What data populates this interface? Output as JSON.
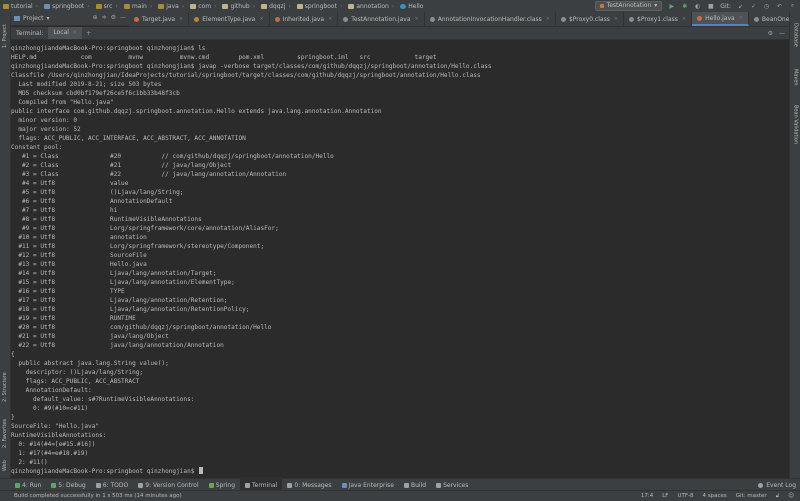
{
  "breadcrumbs": [
    {
      "label": "tutorial",
      "kind": "folder"
    },
    {
      "label": "springboot",
      "kind": "module"
    },
    {
      "label": "src",
      "kind": "folder"
    },
    {
      "label": "main",
      "kind": "folder"
    },
    {
      "label": "java",
      "kind": "folder"
    },
    {
      "label": "com",
      "kind": "package"
    },
    {
      "label": "github",
      "kind": "package"
    },
    {
      "label": "dqqzj",
      "kind": "package"
    },
    {
      "label": "springboot",
      "kind": "package"
    },
    {
      "label": "annotation",
      "kind": "package"
    },
    {
      "label": "Hello",
      "kind": "class"
    }
  ],
  "run_config": {
    "label": "TestAnnotation"
  },
  "git_label": "Git:",
  "project_panel": {
    "label": "Project"
  },
  "editor_tabs": [
    {
      "label": "Target.java",
      "kind": "a"
    },
    {
      "label": "ElementType.java",
      "kind": "e"
    },
    {
      "label": "Inherited.java",
      "kind": "a"
    },
    {
      "label": "TestAnnotation.java",
      "kind": "c"
    },
    {
      "label": "AnnotationInvocationHandler.class",
      "kind": "c"
    },
    {
      "label": "$Proxy0.class",
      "kind": "c"
    },
    {
      "label": "$Proxy1.class",
      "kind": "c"
    },
    {
      "label": "Hello.java",
      "kind": "a",
      "active": true
    },
    {
      "label": "BeanOne.java",
      "kind": "c"
    }
  ],
  "terminal": {
    "title": "Terminal:",
    "tab": "Local",
    "lines": [
      "qinzhongjiandeMacBook-Pro:springboot qinzhongjian$ ls",
      "HELP.md            com          mvnw          mvnw.cmd        pom.xml         springboot.iml   src            target",
      "qinzhongjiandeMacBook-Pro:springboot qinzhongjian$ javap -verbose target/classes/com/github/dqqzj/springboot/annotation/Hello.class",
      "Classfile /Users/qinzhongjian/IdeaProjects/tutorial/springboot/target/classes/com/github/dqqzj/springboot/annotation/Hello.class",
      "  Last modified 2019-8-21; size 503 bytes",
      "  MD5 checksum cbd0bf179ef26ce5f6c1bb33b48f3cb",
      "  Compiled from \"Hello.java\"",
      "public interface com.github.dqqzj.springboot.annotation.Hello extends java.lang.annotation.Annotation",
      "  minor version: 0",
      "  major version: 52",
      "  flags: ACC_PUBLIC, ACC_INTERFACE, ACC_ABSTRACT, ACC_ANNOTATION",
      "Constant pool:",
      "   #1 = Class              #20           // com/github/dqqzj/springboot/annotation/Hello",
      "   #2 = Class              #21           // java/lang/Object",
      "   #3 = Class              #22           // java/lang/annotation/Annotation",
      "   #4 = Utf8               value",
      "   #5 = Utf8               ()Ljava/lang/String;",
      "   #6 = Utf8               AnnotationDefault",
      "   #7 = Utf8               hi",
      "   #8 = Utf8               RuntimeVisibleAnnotations",
      "   #9 = Utf8               Lorg/springframework/core/annotation/AliasFor;",
      "  #10 = Utf8               annotation",
      "  #11 = Utf8               Lorg/springframework/stereotype/Component;",
      "  #12 = Utf8               SourceFile",
      "  #13 = Utf8               Hello.java",
      "  #14 = Utf8               Ljava/lang/annotation/Target;",
      "  #15 = Utf8               Ljava/lang/annotation/ElementType;",
      "  #16 = Utf8               TYPE",
      "  #17 = Utf8               Ljava/lang/annotation/Retention;",
      "  #18 = Utf8               Ljava/lang/annotation/RetentionPolicy;",
      "  #19 = Utf8               RUNTIME",
      "  #20 = Utf8               com/github/dqqzj/springboot/annotation/Hello",
      "  #21 = Utf8               java/lang/Object",
      "  #22 = Utf8               java/lang/annotation/Annotation",
      "{",
      "  public abstract java.lang.String value();",
      "    descriptor: ()Ljava/lang/String;",
      "    flags: ACC_PUBLIC, ACC_ABSTRACT",
      "    AnnotationDefault:",
      "      default_value: s#7RuntimeVisibleAnnotations:",
      "      0: #9(#10=c#11)",
      "}",
      "SourceFile: \"Hello.java\"",
      "RuntimeVisibleAnnotations:",
      "  0: #14(#4=[e#15.#16])",
      "  1: #17(#4=e#18.#19)",
      "  2: #11()",
      "qinzhongjiandeMacBook-Pro:springboot qinzhongjian$ "
    ]
  },
  "left_stripe": [
    "1: Project",
    "2: Structure",
    "2: Favorites",
    "Web"
  ],
  "right_stripe": [
    "Database",
    "Maven",
    "Bean Validation"
  ],
  "tool_windows": [
    {
      "label": "4: Run",
      "color": "#59a869"
    },
    {
      "label": "5: Debug",
      "color": "#59a869"
    },
    {
      "label": "6: TODO",
      "color": "#9fa1a3"
    },
    {
      "label": "9: Version Control",
      "color": "#9fa1a3"
    },
    {
      "label": "Spring",
      "color": "#6da741"
    },
    {
      "label": "Terminal",
      "color": "#9fa1a3",
      "active": true
    },
    {
      "label": "0: Messages",
      "color": "#9fa1a3"
    },
    {
      "label": "Java Enterprise",
      "color": "#6a8fb8"
    },
    {
      "label": "Build",
      "color": "#9fa1a3"
    },
    {
      "label": "Services",
      "color": "#9fa1a3"
    }
  ],
  "event_log": "Event Log",
  "status": {
    "message": "Build completed successfully in 1 s 503 ms (14 minutes ago)",
    "position": "17:4",
    "line_sep": "LF",
    "encoding": "UTF-8",
    "indent": "4 spaces",
    "vcs": "Git: master"
  }
}
